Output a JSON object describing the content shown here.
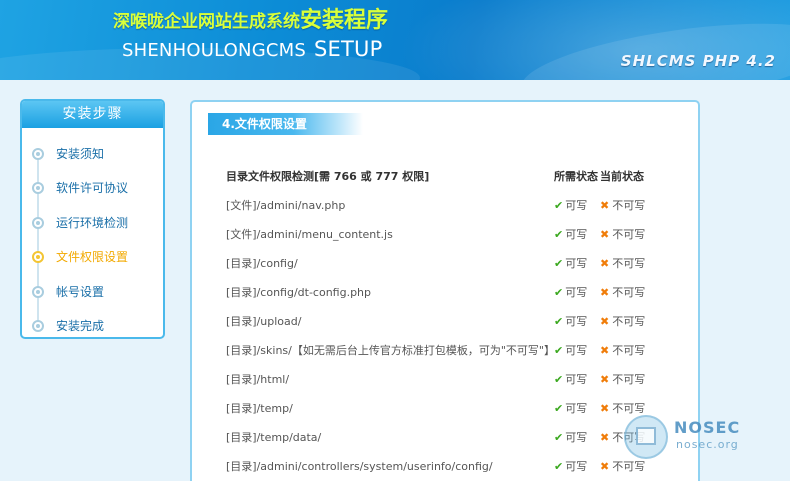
{
  "header": {
    "title_cn": "深喉咙企业网站生成系统",
    "title_cn_big": "安装程序",
    "title_en": "SHENHOULONGCMS",
    "title_en_setup": "SETUP",
    "version": "SHLCMS PHP 4.2"
  },
  "sidebar": {
    "heading": "安装步骤",
    "items": [
      {
        "label": "安装须知",
        "active": false
      },
      {
        "label": "软件许可协议",
        "active": false
      },
      {
        "label": "运行环境检测",
        "active": false
      },
      {
        "label": "文件权限设置",
        "active": true
      },
      {
        "label": "帐号设置",
        "active": false
      },
      {
        "label": "安装完成",
        "active": false
      }
    ]
  },
  "main": {
    "section_title": "4.文件权限设置",
    "columns": {
      "path": "目录文件权限检测[需 766 或 777 权限]",
      "required": "所需状态",
      "current": "当前状态"
    },
    "rows": [
      {
        "path": "[文件]/admini/nav.php",
        "required": "可写",
        "current": "不可写"
      },
      {
        "path": "[文件]/admini/menu_content.js",
        "required": "可写",
        "current": "不可写"
      },
      {
        "path": "[目录]/config/",
        "required": "可写",
        "current": "不可写"
      },
      {
        "path": "[目录]/config/dt-config.php",
        "required": "可写",
        "current": "不可写"
      },
      {
        "path": "[目录]/upload/",
        "required": "可写",
        "current": "不可写"
      },
      {
        "path": "[目录]/skins/【如无需后台上传官方标准打包模板，可为\"不可写\"】",
        "required": "可写",
        "current": "不可写"
      },
      {
        "path": "[目录]/html/",
        "required": "可写",
        "current": "不可写"
      },
      {
        "path": "[目录]/temp/",
        "required": "可写",
        "current": "不可写"
      },
      {
        "path": "[目录]/temp/data/",
        "required": "可写",
        "current": "不可写"
      },
      {
        "path": "[目录]/admini/controllers/system/userinfo/config/",
        "required": "可写",
        "current": "不可写"
      }
    ]
  },
  "watermark": {
    "title": "NOSEC",
    "subtitle": "nosec.org"
  },
  "icons": {
    "ok": "check-icon",
    "fail": "cross-icon"
  },
  "colors": {
    "header_blue": "#0c8cd6",
    "title_yellow": "#d9ff3a",
    "active_step": "#f2a900",
    "check_green": "#3aa81e",
    "cross_orange": "#f07d0a"
  }
}
